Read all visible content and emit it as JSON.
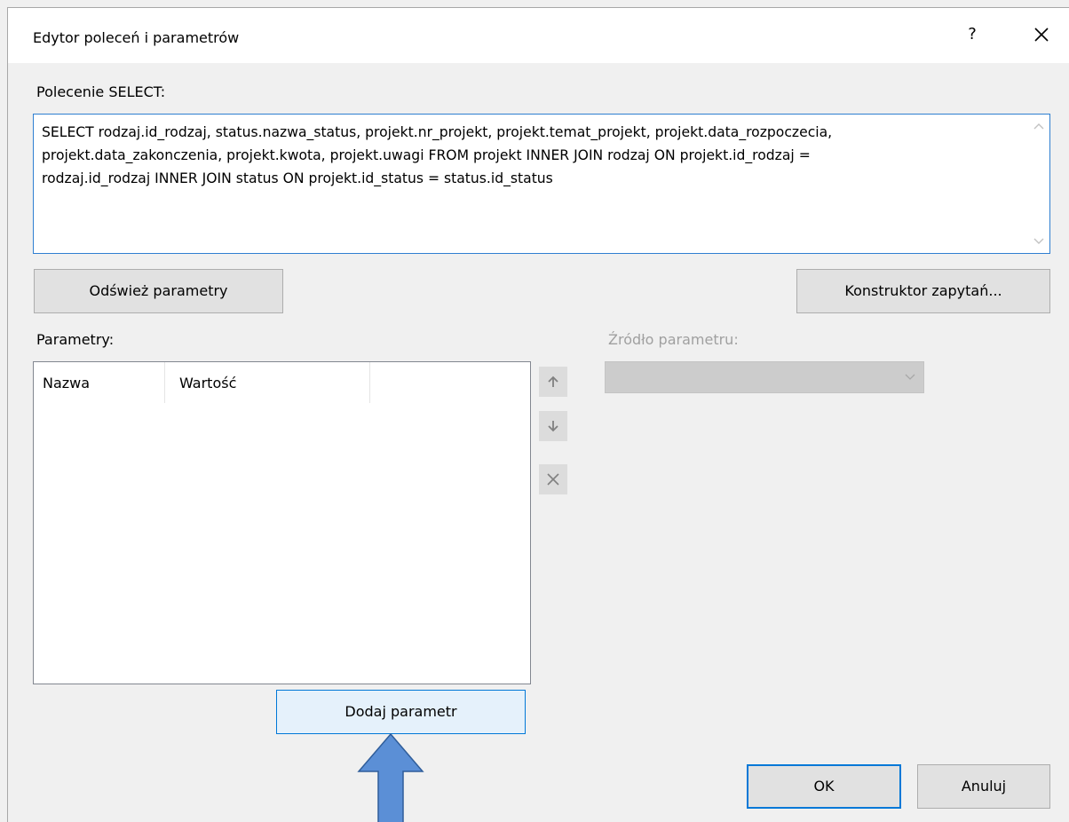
{
  "dialog": {
    "title": "Edytor poleceń i parametrów",
    "help_glyph": "?",
    "close_icon": "close-icon"
  },
  "select_command": {
    "label": "Polecenie SELECT:",
    "value": "SELECT rodzaj.id_rodzaj, status.nazwa_status, projekt.nr_projekt, projekt.temat_projekt, projekt.data_rozpoczecia,\nprojekt.data_zakonczenia, projekt.kwota, projekt.uwagi FROM projekt INNER JOIN rodzaj ON projekt.id_rodzaj =\nrodzaj.id_rodzaj INNER JOIN status ON projekt.id_status = status.id_status"
  },
  "buttons": {
    "refresh_parameters": "Odśwież parametry",
    "query_builder": "Konstruktor zapytań...",
    "add_parameter": "Dodaj parametr",
    "ok": "OK",
    "cancel": "Anuluj"
  },
  "parameters": {
    "label": "Parametry:",
    "columns": [
      "Nazwa",
      "Wartość"
    ],
    "rows": []
  },
  "parameter_source": {
    "label": "Źródło parametru:",
    "selected": "",
    "enabled": false
  },
  "side_actions": {
    "move_up_icon": "arrow-up-icon",
    "move_down_icon": "arrow-down-icon",
    "delete_icon": "delete-icon"
  },
  "annotation": {
    "arrow_color": "#5b8fd6",
    "arrow_outline": "#2f5d9a"
  },
  "colors": {
    "accent": "#0078d7",
    "focus_border": "#2f7fd1",
    "dialog_bg": "#f0f0f0",
    "disabled_text": "#a0a0a0"
  }
}
